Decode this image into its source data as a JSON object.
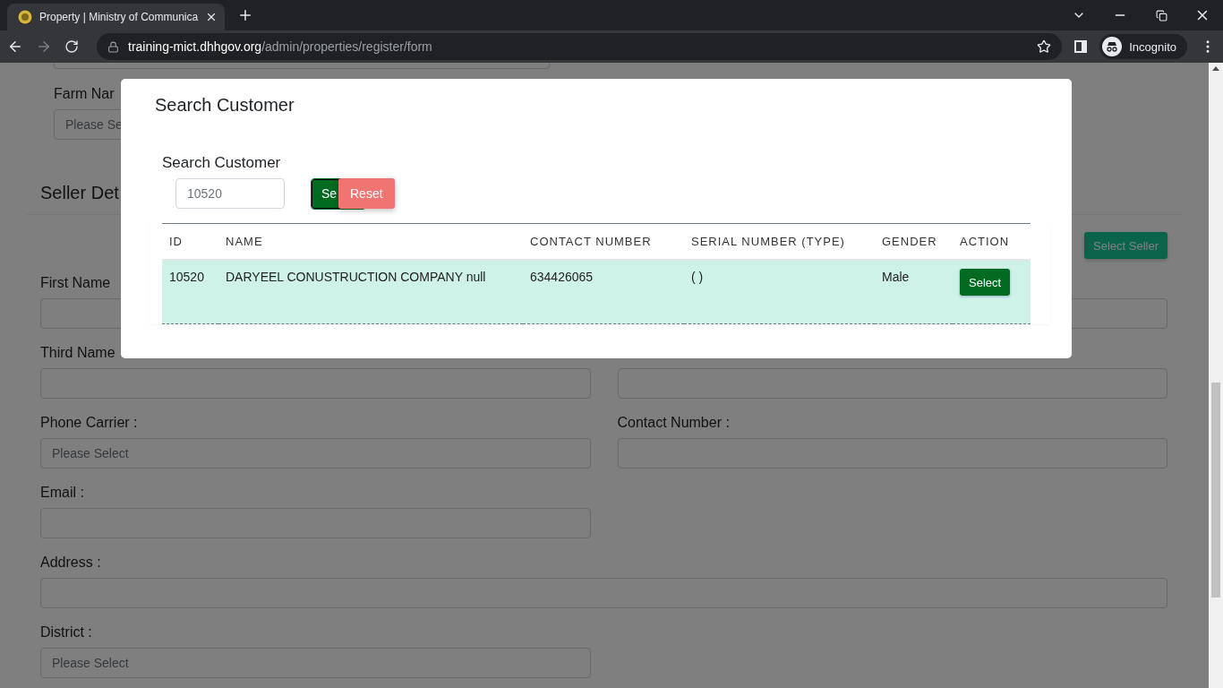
{
  "browser": {
    "tab": {
      "title": "Property | Ministry of Communica",
      "selected": true
    },
    "forward_disabled": true,
    "url_host": "training-mict.dhhgov.org",
    "url_path": "/admin/properties/register/form",
    "profile_label": "Incognito"
  },
  "page": {
    "farm_label": "Farm Nar",
    "farm_placeholder": "Please Se",
    "section_title": "Seller Det",
    "select_seller": "Select Seller",
    "rows": [
      {
        "kind": "pair",
        "cells": [
          {
            "label": "First Name"
          },
          {}
        ]
      },
      {
        "kind": "pair",
        "cells": [
          {
            "label": "Third Name"
          },
          {}
        ]
      },
      {
        "kind": "pair",
        "cells": [
          {
            "label": "Phone Carrier :",
            "placeholder": "Please Select"
          },
          {
            "label": "Contact Number :"
          }
        ]
      },
      {
        "kind": "pair",
        "cells": [
          {
            "label": "Email :"
          }
        ]
      },
      {
        "kind": "wide",
        "cells": [
          {
            "label": "Address :"
          }
        ]
      },
      {
        "kind": "pair",
        "cells": [
          {
            "label": "District :",
            "placeholder": "Please Select"
          }
        ]
      }
    ]
  },
  "modal": {
    "title": "Search Customer",
    "search_label": "Search Customer",
    "search_value": "10520",
    "search_button": "Se",
    "reset_button": "Reset",
    "table": {
      "columns": [
        "ID",
        "NAME",
        "CONTACT NUMBER",
        "SERIAL NUMBER (TYPE)",
        "GENDER",
        "ACTION"
      ],
      "rows": [
        {
          "highlighted": true,
          "cells": [
            "10520",
            "DARYEEL CONUSTRUCTION COMPANY null",
            "634426065",
            "( )",
            "Male"
          ],
          "action": "Select"
        }
      ]
    }
  }
}
